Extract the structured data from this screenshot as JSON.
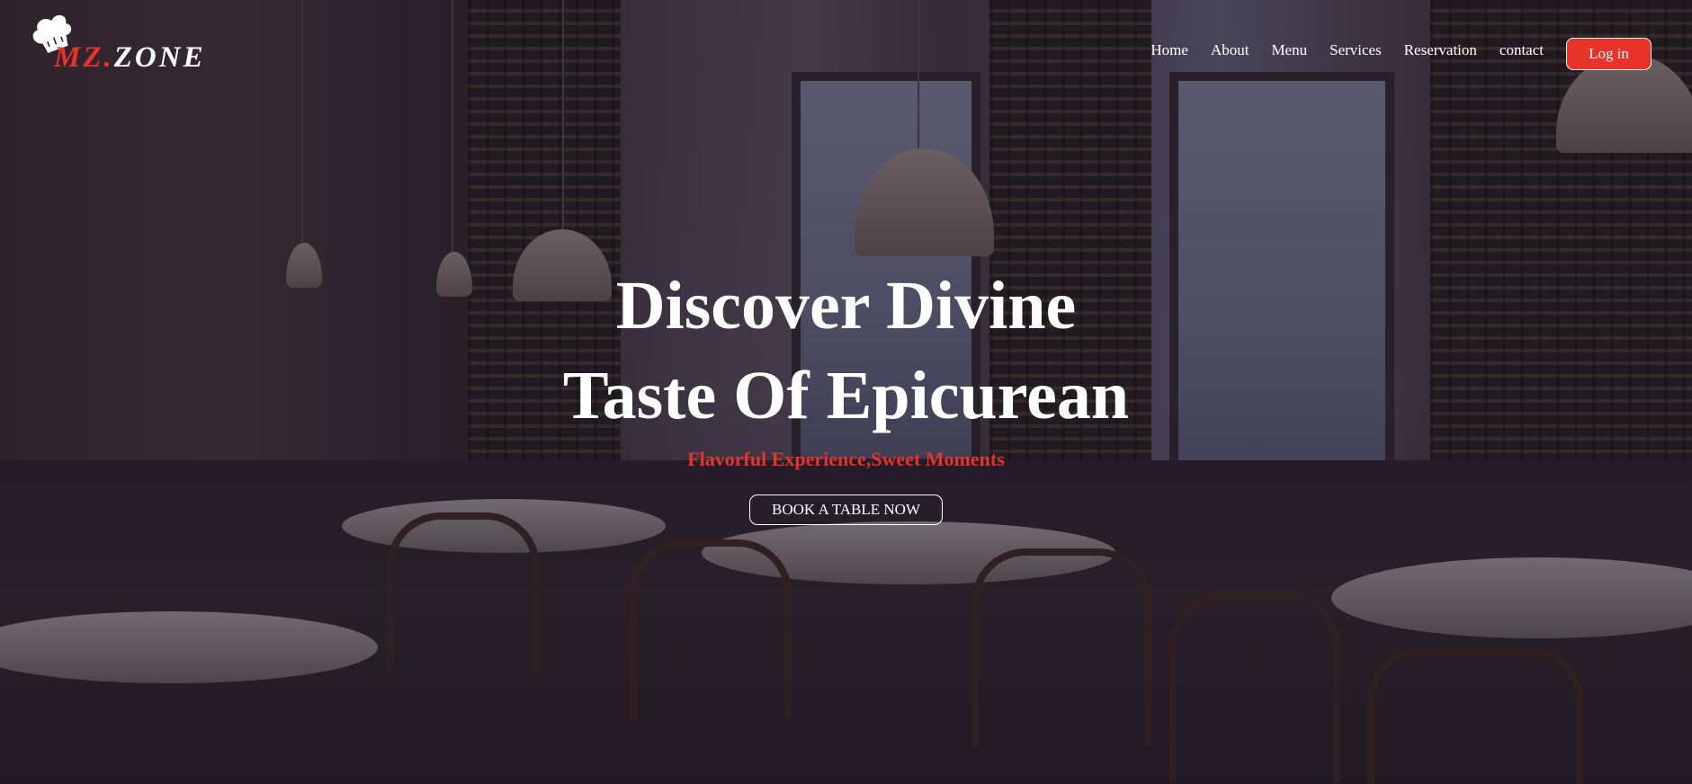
{
  "brand": {
    "name_part1": "MZ.",
    "name_part2": "ZONE"
  },
  "nav": {
    "items": [
      "Home",
      "About",
      "Menu",
      "Services",
      "Reservation",
      "contact"
    ],
    "login_label": "Log in"
  },
  "hero": {
    "title_line1": "Discover Divine",
    "title_line2": "Taste Of Epicurean",
    "tagline": "Flavorful Experience,Sweet Moments",
    "cta_label": "BOOK A TABLE NOW"
  },
  "colors": {
    "accent": "#e8322a",
    "text": "#ffffff",
    "overlay": "#1c182c"
  },
  "icons": {
    "logo": "chef-hat-icon"
  }
}
